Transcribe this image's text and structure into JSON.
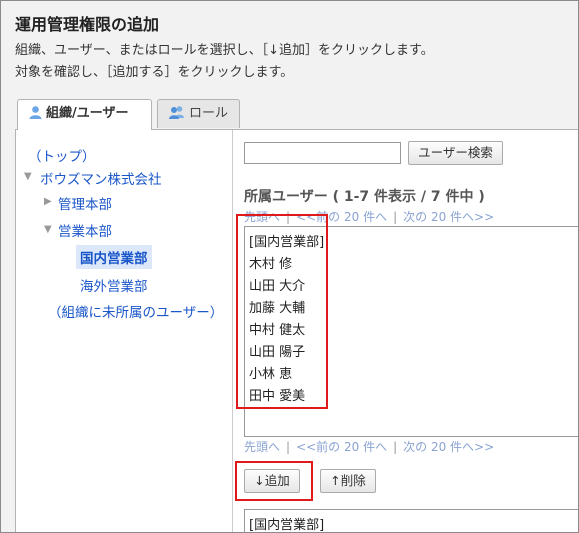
{
  "page": {
    "title": "運用管理権限の追加",
    "desc_line1": "組織、ユーザー、またはロールを選択し、［↓追加］をクリックします。",
    "desc_line2": "対象を確認し、［追加する］をクリックします。"
  },
  "tabs": [
    {
      "label": "組織/ユーザー",
      "icon": "user-icon",
      "active": true
    },
    {
      "label": "ロール",
      "icon": "users-icon",
      "active": false
    }
  ],
  "tree": {
    "top": "（トップ）",
    "company": "ボウズマン株式会社",
    "dept1": "管理本部",
    "dept2": "営業本部",
    "sub1": "国内営業部",
    "sub2": "海外営業部",
    "unassigned": "（組織に未所属のユーザー）"
  },
  "search": {
    "value": "",
    "button": "ユーザー検索"
  },
  "members": {
    "title": "所属ユーザー ( 1-7 件表示 / 7 件中 )",
    "pager_first": "先頭へ",
    "pager_prev": "<<前の 20 件へ",
    "pager_next": "次の 20 件へ>>",
    "sep": "|",
    "items": [
      "[国内営業部]",
      "木村 修",
      "山田 大介",
      "加藤 大輔",
      "中村 健太",
      "山田 陽子",
      "小林 恵",
      "田中 愛美"
    ]
  },
  "actions": {
    "add": "↓追加",
    "remove": "↑削除"
  },
  "selected": {
    "items": [
      "[国内営業部]"
    ]
  },
  "colors": {
    "link": "#1a56c9",
    "highlight": "#e0191a",
    "selected_bg": "#dce8fa"
  }
}
